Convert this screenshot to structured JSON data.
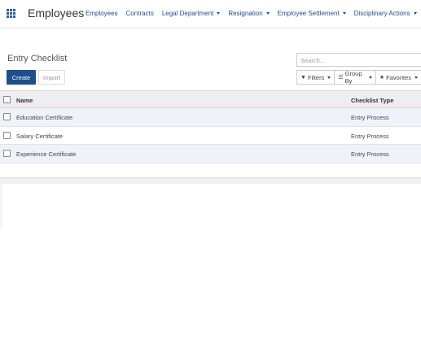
{
  "app": {
    "title": "Employees"
  },
  "menu": [
    {
      "label": "Employees",
      "dropdown": false
    },
    {
      "label": "Contracts",
      "dropdown": false
    },
    {
      "label": "Legal Department",
      "dropdown": true
    },
    {
      "label": "Resignation",
      "dropdown": true
    },
    {
      "label": "Employee Settlement",
      "dropdown": true
    },
    {
      "label": "Disciplinary Actions",
      "dropdown": true
    }
  ],
  "page": {
    "title": "Entry Checklist"
  },
  "actions": {
    "create_label": "Create",
    "import_label": "Import"
  },
  "search": {
    "placeholder": "Search..."
  },
  "filters": {
    "filters_label": "Filters",
    "group_by_label": "Group By",
    "favorites_label": "Favorites"
  },
  "table": {
    "columns": {
      "name": "Name",
      "checklist_type": "Checklist Type"
    },
    "rows": [
      {
        "name": "Education Certificate",
        "checklist_type": "Entry Process"
      },
      {
        "name": "Salary Certificate",
        "checklist_type": "Entry Process"
      },
      {
        "name": "Experience Certificate",
        "checklist_type": "Entry Process"
      }
    ]
  },
  "colors": {
    "brand": "#1f4e8c",
    "row_alt": "#eef3f9"
  }
}
